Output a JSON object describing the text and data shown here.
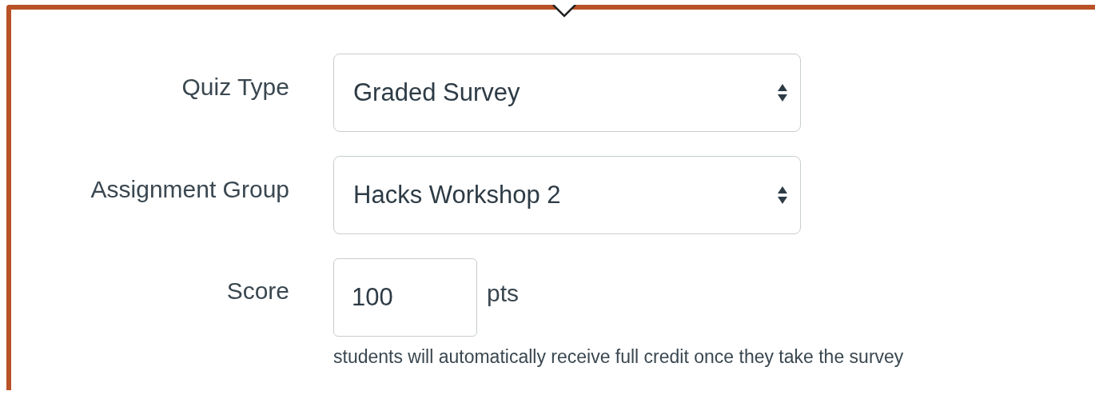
{
  "fields": [
    {
      "kind": "select",
      "label": "Quiz Type",
      "value": "Graded Survey"
    },
    {
      "kind": "select",
      "label": "Assignment Group",
      "value": "Hacks Workshop 2"
    },
    {
      "kind": "number",
      "label": "Score",
      "value": "100",
      "unit": "pts",
      "help": "students will automatically receive full credit once they take the survey"
    }
  ]
}
